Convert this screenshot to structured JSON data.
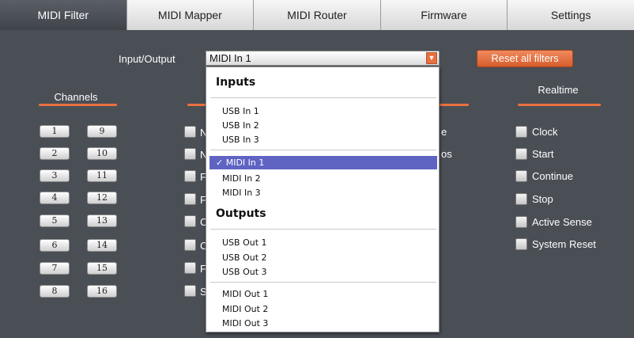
{
  "tabs": [
    "MIDI Filter",
    "MIDI Mapper",
    "MIDI Router",
    "Firmware",
    "Settings"
  ],
  "io": {
    "label": "Input/Output",
    "selected": "MIDI In 1",
    "arrow": "▼"
  },
  "reset_label": "Reset all filters",
  "channels": {
    "title": "Channels",
    "left": [
      "1",
      "2",
      "3",
      "4",
      "5",
      "6",
      "7",
      "8"
    ],
    "right": [
      "9",
      "10",
      "11",
      "12",
      "13",
      "14",
      "15",
      "16"
    ]
  },
  "middle": {
    "row1_text": "N",
    "row2_text": "N",
    "row3_text": "F",
    "row4_text": "F",
    "row5_text": "C",
    "row6_text": "C",
    "row7_text": "F",
    "row8_text": "S",
    "right_row1_text": "e",
    "right_row2_text": "os"
  },
  "realtime": {
    "title": "Realtime",
    "items": [
      "Clock",
      "Start",
      "Continue",
      "Stop",
      "Active Sense",
      "System Reset"
    ]
  },
  "dropdown": {
    "inputs_heading": "Inputs",
    "usb_inputs": [
      "USB In 1",
      "USB In 2",
      "USB In 3"
    ],
    "selected": "✓ MIDI In 1",
    "midi_inputs": [
      "MIDI In 2",
      "MIDI In 3"
    ],
    "outputs_heading": "Outputs",
    "usb_outputs": [
      "USB Out 1",
      "USB Out 2",
      "USB Out 3"
    ],
    "midi_outputs": [
      "MIDI Out 1",
      "MIDI Out 2",
      "MIDI Out 3"
    ]
  },
  "colors": {
    "accent": "#e8703f",
    "background": "#4a4e55",
    "selection": "#5f63c2"
  }
}
